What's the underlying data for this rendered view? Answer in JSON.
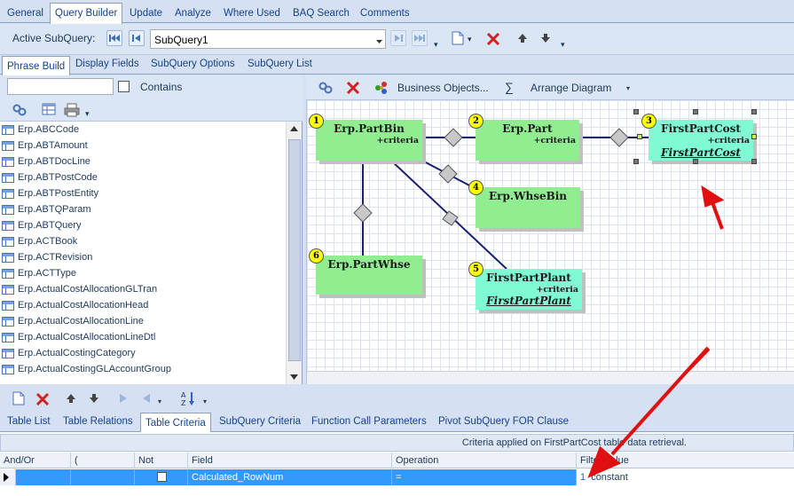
{
  "top_tabs": [
    "General",
    "Query Builder",
    "Update",
    "Analyze",
    "Where Used",
    "BAQ Search",
    "Comments"
  ],
  "subquery_toolbar": {
    "label": "Active SubQuery:",
    "value": "SubQuery1"
  },
  "section_tabs": [
    "Phrase Build",
    "Display Fields",
    "SubQuery Options",
    "SubQuery List"
  ],
  "search": {
    "value": "",
    "contains_label": "Contains"
  },
  "table_list": [
    "Erp.ABCCode",
    "Erp.ABTAmount",
    "Erp.ABTDocLine",
    "Erp.ABTPostCode",
    "Erp.ABTPostEntity",
    "Erp.ABTQParam",
    "Erp.ABTQuery",
    "Erp.ACTBook",
    "Erp.ACTRevision",
    "Erp.ACTType",
    "Erp.ActualCostAllocationGLTran",
    "Erp.ActualCostAllocationHead",
    "Erp.ActualCostAllocationLine",
    "Erp.ActualCostAllocationLineDtl",
    "Erp.ActualCostingCategory",
    "Erp.ActualCostingGLAccountGroup"
  ],
  "diagram_toolbar": {
    "business_objects": "Business Objects...",
    "sigma": "∑",
    "arrange": "Arrange Diagram"
  },
  "nodes": [
    {
      "num": "1",
      "title": "Erp.PartBin",
      "crit": "+criteria",
      "ref": ""
    },
    {
      "num": "2",
      "title": "Erp.Part",
      "crit": "+criteria",
      "ref": ""
    },
    {
      "num": "3",
      "title": "FirstPartCost",
      "crit": "+criteria",
      "ref": "FirstPartCost"
    },
    {
      "num": "4",
      "title": "Erp.WhseBin",
      "crit": "",
      "ref": ""
    },
    {
      "num": "5",
      "title": "FirstPartPlant",
      "crit": "+criteria",
      "ref": "FirstPartPlant"
    },
    {
      "num": "6",
      "title": "Erp.PartWhse",
      "crit": "",
      "ref": ""
    }
  ],
  "bottom_tabs": [
    "Table List",
    "Table Relations",
    "Table Criteria",
    "SubQuery Criteria",
    "Function Call Parameters",
    "Pivot SubQuery FOR Clause"
  ],
  "criteria": {
    "info": "Criteria applied on FirstPartCost table data retrieval.",
    "columns": [
      "And/Or",
      "(",
      "Not",
      "Field",
      "Operation",
      "Filter Value"
    ],
    "row": {
      "and_or": "",
      "paren": "",
      "field": "Calculated_RowNum",
      "operation": "=",
      "filter_num": "1",
      "filter_value": "constant"
    }
  },
  "colors": {
    "node_green": "#90ee90",
    "node_cyan": "#7ffad4",
    "selection": "#3399ff",
    "arrow_red": "#e01010"
  }
}
